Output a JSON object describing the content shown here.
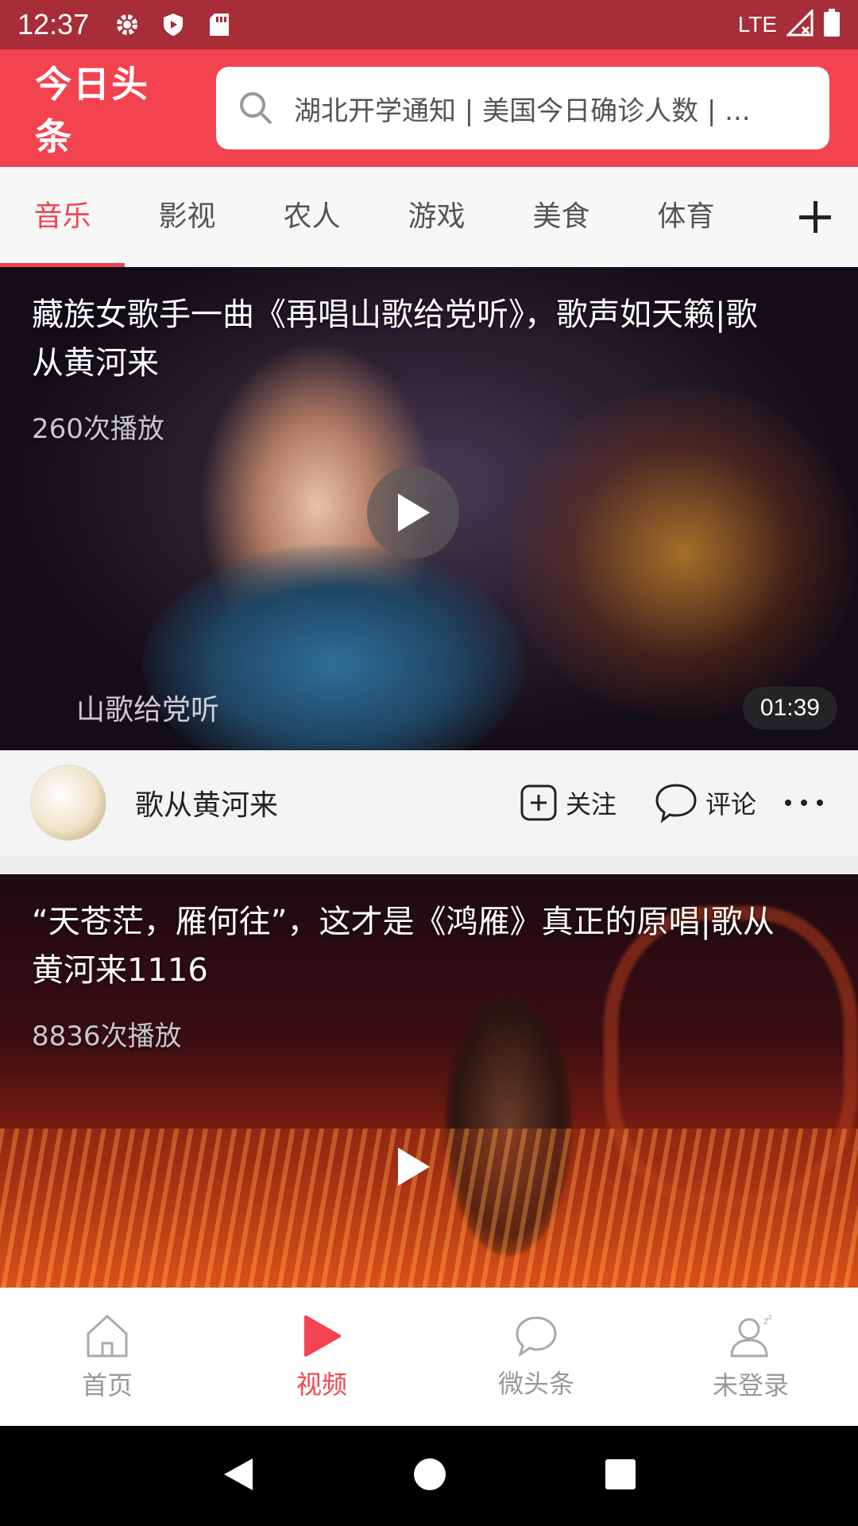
{
  "status_bar": {
    "time": "12:37",
    "network": "LTE",
    "icons": [
      "gear-icon",
      "shield-icon",
      "sd-card-icon",
      "signal-icon",
      "battery-icon"
    ]
  },
  "header": {
    "logo": "今日头条",
    "search_placeholder": "湖北开学通知 | 美国今日确诊人数 | ..."
  },
  "tabs": {
    "items": [
      "音乐",
      "影视",
      "农人",
      "游戏",
      "美食",
      "体育"
    ],
    "active_index": 0,
    "add_icon": "plus-icon"
  },
  "videos": [
    {
      "title": "藏族女歌手一曲《再唱山歌给党听》，歌声如天籁|歌从黄河来",
      "views": "260次播放",
      "duration": "01:39",
      "caption": "山歌给党听"
    },
    {
      "title": "“天苍茫，雁何往”，这才是《鸿雁》真正的原唱|歌从黄河来1116",
      "views": "8836次播放"
    }
  ],
  "card_footer": {
    "author": "歌从黄河来",
    "follow_label": "关注",
    "comment_label": "评论"
  },
  "bottom_nav": {
    "items": [
      {
        "label": "首页",
        "icon": "home-icon"
      },
      {
        "label": "视频",
        "icon": "video-play-icon"
      },
      {
        "label": "微头条",
        "icon": "chat-bubble-icon"
      },
      {
        "label": "未登录",
        "icon": "user-icon"
      }
    ],
    "active_index": 1
  },
  "colors": {
    "brand_red": "#f2434f",
    "status_bar": "#a72d39"
  }
}
